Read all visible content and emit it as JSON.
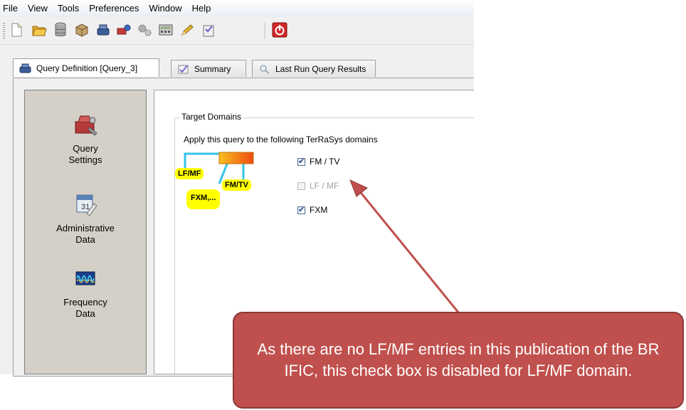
{
  "menubar": {
    "items": [
      {
        "label": "File"
      },
      {
        "label": "View"
      },
      {
        "label": "Tools"
      },
      {
        "label": "Preferences"
      },
      {
        "label": "Window"
      },
      {
        "label": "Help"
      }
    ]
  },
  "toolbar": {
    "buttons": [
      {
        "icon": "new-document-icon"
      },
      {
        "icon": "open-folder-icon"
      },
      {
        "icon": "database-icon"
      },
      {
        "icon": "package-icon"
      },
      {
        "icon": "query-icon"
      },
      {
        "icon": "run-query-icon"
      },
      {
        "icon": "settings-gears-icon"
      },
      {
        "icon": "calculator-icon"
      },
      {
        "icon": "pencil-icon"
      },
      {
        "icon": "clipboard-icon"
      },
      {
        "icon": "power-icon"
      }
    ]
  },
  "tabs": [
    {
      "label": "Query Definition [Query_3]",
      "icon": "query-definition-icon",
      "active": true
    },
    {
      "label": "Summary",
      "icon": "summary-icon",
      "active": false
    },
    {
      "label": "Last Run Query Results",
      "icon": "results-icon",
      "active": false
    }
  ],
  "side_nav": {
    "items": [
      {
        "label_line1": "Query",
        "label_line2": "Settings",
        "icon": "toolbox-icon"
      },
      {
        "label_line1": "Administrative",
        "label_line2": "Data",
        "icon": "calendar-icon"
      },
      {
        "label_line1": "Frequency",
        "label_line2": "Data",
        "icon": "frequency-icon"
      }
    ]
  },
  "target_domains": {
    "title": "Target Domains",
    "description": "Apply this query to the following TerRaSys domains",
    "diagram_labels": {
      "lfmf": "LF/MF",
      "fmtv": "FM/TV",
      "fxm": "FXM,..."
    },
    "checkboxes": [
      {
        "label": "FM / TV",
        "checked": true,
        "enabled": true
      },
      {
        "label": "LF / MF",
        "checked": false,
        "enabled": false
      },
      {
        "label": "FXM",
        "checked": true,
        "enabled": true
      }
    ]
  },
  "callout": {
    "text": "As there are no LF/MF entries in this publication of the BR IFIC, this check box is disabled for LF/MF domain.",
    "color": "#c0504d"
  }
}
